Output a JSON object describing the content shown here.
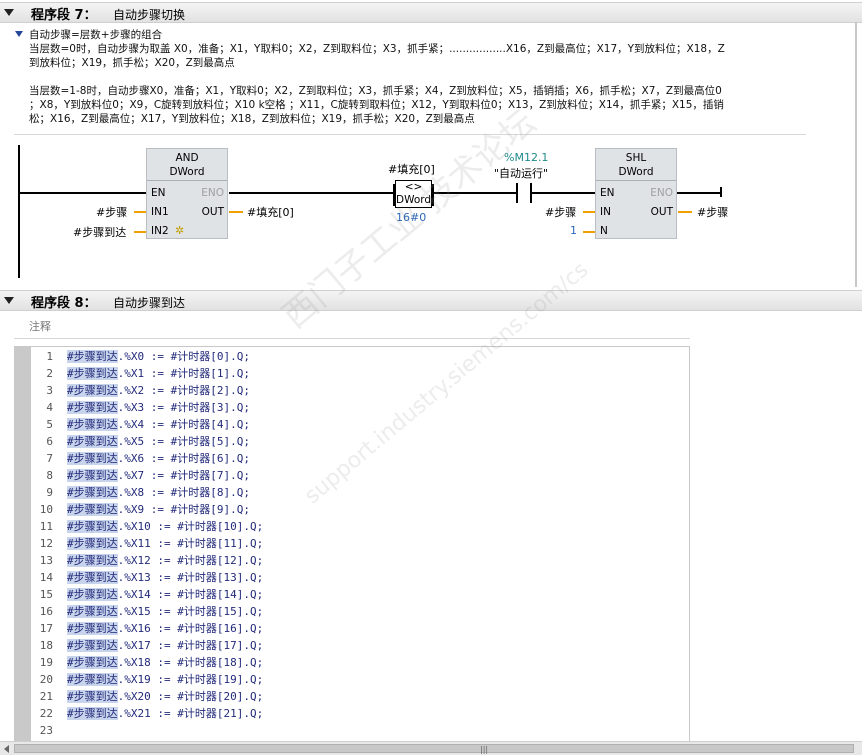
{
  "network7": {
    "prefix": "程序段 7：",
    "title": "自动步骤切换",
    "comment_lines": [
      "自动步骤=层数+步骤的组合",
      "当层数=0时，自动步骤为取盖 X0，准备；X1，Y取料0；X2，Z到取料位；X3，抓手紧；.................X16，Z到最高位；X17，Y到放料位；X18，Z",
      "到放料位；X19，抓手松；X20，Z到最高点",
      "",
      "当层数=1-8时，自动步骤X0，准备；X1，Y取料0；X2，Z到取料位；X3，抓手紧；X4，Z到放料位；X5，插销插；X6，抓手松；X7，Z到最高位0",
      "；X8，Y到放料位0；X9，C旋转到放料位；X10 k空格 ；X11，C旋转到取料位；X12，Y到取料位0；X13，Z到放料位；X14，抓手紧；X15，插销",
      "松；X16，Z到最高位；X17，Y到放料位；X18，Z到放料位；X19，抓手松；X20，Z到最高点"
    ],
    "and_block": {
      "name": "AND",
      "type": "DWord",
      "en": "EN",
      "eno": "ENO",
      "in1": "IN1",
      "in2": "IN2",
      "out": "OUT",
      "in1_operand": "#步骤",
      "in2_operand": "#步骤到达",
      "out_operand": "#填充[0]"
    },
    "compare": {
      "operand": "#填充[0]",
      "symbol": "<>",
      "type": "DWord",
      "value": "16#0"
    },
    "contact": {
      "address": "%M12.1",
      "symbol": "\"自动运行\""
    },
    "shl_block": {
      "name": "SHL",
      "type": "DWord",
      "en": "EN",
      "eno": "ENO",
      "in": "IN",
      "n": "N",
      "out": "OUT",
      "in_operand": "#步骤",
      "n_operand": "1",
      "out_operand": "#步骤"
    }
  },
  "network8": {
    "prefix": "程序段 8：",
    "title": "自动步骤到达",
    "comment_placeholder": "注释",
    "code_lines": [
      {
        "n": "1",
        "var": "#步骤到达",
        "rest": ".%X0 := #计时器[0].Q;"
      },
      {
        "n": "2",
        "var": "#步骤到达",
        "rest": ".%X1 := #计时器[1].Q;"
      },
      {
        "n": "3",
        "var": "#步骤到达",
        "rest": ".%X2 := #计时器[2].Q;"
      },
      {
        "n": "4",
        "var": "#步骤到达",
        "rest": ".%X3 := #计时器[3].Q;"
      },
      {
        "n": "5",
        "var": "#步骤到达",
        "rest": ".%X4 := #计时器[4].Q;"
      },
      {
        "n": "6",
        "var": "#步骤到达",
        "rest": ".%X5 := #计时器[5].Q;"
      },
      {
        "n": "7",
        "var": "#步骤到达",
        "rest": ".%X6 := #计时器[6].Q;"
      },
      {
        "n": "8",
        "var": "#步骤到达",
        "rest": ".%X7 := #计时器[7].Q;"
      },
      {
        "n": "9",
        "var": "#步骤到达",
        "rest": ".%X8 := #计时器[8].Q;"
      },
      {
        "n": "10",
        "var": "#步骤到达",
        "rest": ".%X9 := #计时器[9].Q;"
      },
      {
        "n": "11",
        "var": "#步骤到达",
        "rest": ".%X10 := #计时器[10].Q;"
      },
      {
        "n": "12",
        "var": "#步骤到达",
        "rest": ".%X11 := #计时器[11].Q;"
      },
      {
        "n": "13",
        "var": "#步骤到达",
        "rest": ".%X12 := #计时器[12].Q;"
      },
      {
        "n": "14",
        "var": "#步骤到达",
        "rest": ".%X13 := #计时器[13].Q;"
      },
      {
        "n": "15",
        "var": "#步骤到达",
        "rest": ".%X14 := #计时器[14].Q;"
      },
      {
        "n": "16",
        "var": "#步骤到达",
        "rest": ".%X15 := #计时器[15].Q;"
      },
      {
        "n": "17",
        "var": "#步骤到达",
        "rest": ".%X16 := #计时器[16].Q;"
      },
      {
        "n": "18",
        "var": "#步骤到达",
        "rest": ".%X17 := #计时器[17].Q;"
      },
      {
        "n": "19",
        "var": "#步骤到达",
        "rest": ".%X18 := #计时器[18].Q;"
      },
      {
        "n": "20",
        "var": "#步骤到达",
        "rest": ".%X19 := #计时器[19].Q;"
      },
      {
        "n": "21",
        "var": "#步骤到达",
        "rest": ".%X20 := #计时器[20].Q;"
      },
      {
        "n": "22",
        "var": "#步骤到达",
        "rest": ".%X21 := #计时器[21].Q;"
      },
      {
        "n": "23",
        "var": "",
        "rest": ""
      }
    ]
  },
  "watermark": {
    "line1": "西门子工业  技术论坛",
    "line2": "support.industry.siemens.com/cs"
  },
  "colors": {
    "header_bg": "#e6e6e6",
    "block_bg": "#dfe3e6",
    "pin_stub": "#f0a000",
    "operand_blue": "#2a65b7",
    "address_teal": "#1f8a8a",
    "scl_var_highlight": "#c8d4ec",
    "scl_text": "#222a7a"
  }
}
